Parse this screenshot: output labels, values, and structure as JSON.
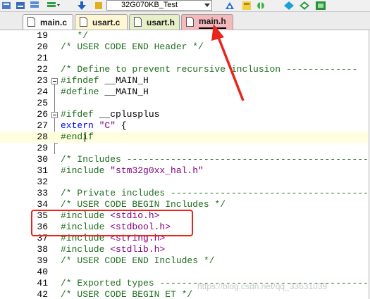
{
  "toolbar": {
    "project_target": "32G070KB_Test"
  },
  "tabs": [
    {
      "label": "main.c",
      "active": false
    },
    {
      "label": "usart.c",
      "active": false
    },
    {
      "label": "usart.h",
      "active": false
    },
    {
      "label": "main.h",
      "active": true
    }
  ],
  "editor": {
    "lines": [
      {
        "num": "19",
        "segs": [
          {
            "t": "   */",
            "c": "comment"
          }
        ]
      },
      {
        "num": "20",
        "segs": [
          {
            "t": "/* USER CODE END Header */",
            "c": "comment"
          }
        ]
      },
      {
        "num": "21",
        "segs": []
      },
      {
        "num": "22",
        "segs": [
          {
            "t": "/* Define to prevent recursive inclusion -------------",
            "c": "comment"
          }
        ]
      },
      {
        "num": "23",
        "segs": [
          {
            "t": "#ifndef ",
            "c": "pre"
          },
          {
            "t": "__MAIN_H",
            "c": "norm"
          }
        ]
      },
      {
        "num": "24",
        "segs": [
          {
            "t": "#define ",
            "c": "pre"
          },
          {
            "t": "__MAIN_H",
            "c": "norm"
          }
        ]
      },
      {
        "num": "25",
        "segs": []
      },
      {
        "num": "26",
        "segs": [
          {
            "t": "#ifdef ",
            "c": "pre"
          },
          {
            "t": "__cplusplus",
            "c": "norm"
          }
        ]
      },
      {
        "num": "27",
        "segs": [
          {
            "t": "extern ",
            "c": "kw"
          },
          {
            "t": "\"C\"",
            "c": "str"
          },
          {
            "t": " {",
            "c": "norm"
          }
        ]
      },
      {
        "num": "28",
        "segs": [
          {
            "t": "#endif",
            "c": "pre"
          }
        ]
      },
      {
        "num": "29",
        "segs": []
      },
      {
        "num": "30",
        "segs": [
          {
            "t": "/* Includes --------------------------------------------",
            "c": "comment"
          }
        ]
      },
      {
        "num": "31",
        "segs": [
          {
            "t": "#include ",
            "c": "pre"
          },
          {
            "t": "\"stm32g0xx_hal.h\"",
            "c": "str"
          }
        ]
      },
      {
        "num": "32",
        "segs": []
      },
      {
        "num": "33",
        "segs": [
          {
            "t": "/* Private includes -------------------------------------",
            "c": "comment"
          }
        ]
      },
      {
        "num": "34",
        "segs": [
          {
            "t": "/* USER CODE BEGIN Includes */",
            "c": "comment"
          }
        ]
      },
      {
        "num": "35",
        "segs": [
          {
            "t": "#include ",
            "c": "pre"
          },
          {
            "t": "<stdio.h>",
            "c": "str"
          }
        ]
      },
      {
        "num": "36",
        "segs": [
          {
            "t": "#include ",
            "c": "pre"
          },
          {
            "t": "<stdbool.h>",
            "c": "str"
          }
        ]
      },
      {
        "num": "37",
        "segs": [
          {
            "t": "#include ",
            "c": "pre"
          },
          {
            "t": "<string.h>",
            "c": "str"
          }
        ]
      },
      {
        "num": "38",
        "segs": [
          {
            "t": "#include ",
            "c": "pre"
          },
          {
            "t": "<stdlib.h>",
            "c": "str"
          }
        ]
      },
      {
        "num": "39",
        "segs": [
          {
            "t": "/* USER CODE END Includes */",
            "c": "comment"
          }
        ]
      },
      {
        "num": "40",
        "segs": []
      },
      {
        "num": "41",
        "segs": [
          {
            "t": "/* Exported types ---------------------------------------",
            "c": "comment"
          }
        ]
      },
      {
        "num": "42",
        "segs": [
          {
            "t": "/* USER CODE BEGIN ET */",
            "c": "comment"
          }
        ]
      }
    ]
  },
  "watermark": "https://blog.csdn.net/qq_33631039"
}
